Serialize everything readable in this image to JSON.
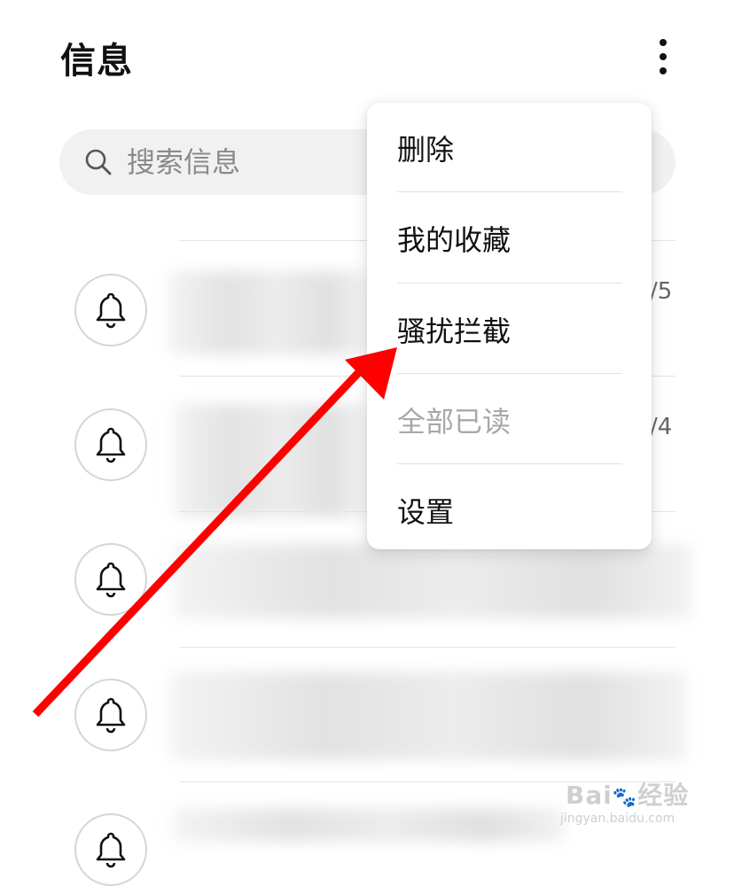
{
  "header": {
    "title": "信息",
    "more_icon": "more-vertical-icon"
  },
  "search": {
    "placeholder": "搜索信息",
    "icon": "search-icon"
  },
  "conversations": [
    {
      "icon": "bell-icon",
      "date_fragment": "/5"
    },
    {
      "icon": "bell-icon",
      "date_fragment": "/4"
    },
    {
      "icon": "bell-icon"
    },
    {
      "icon": "bell-icon"
    },
    {
      "icon": "bell-icon"
    }
  ],
  "menu": {
    "items": [
      {
        "label": "删除",
        "enabled": true
      },
      {
        "label": "我的收藏",
        "enabled": true
      },
      {
        "label": "骚扰拦截",
        "enabled": true
      },
      {
        "label": "全部已读",
        "enabled": false
      },
      {
        "label": "设置",
        "enabled": true
      }
    ]
  },
  "annotation": {
    "arrow_color": "#ff0000",
    "target": "骚扰拦截"
  },
  "watermark": {
    "logo": "Bai du 经验",
    "url": "jingyan.baidu.com"
  }
}
